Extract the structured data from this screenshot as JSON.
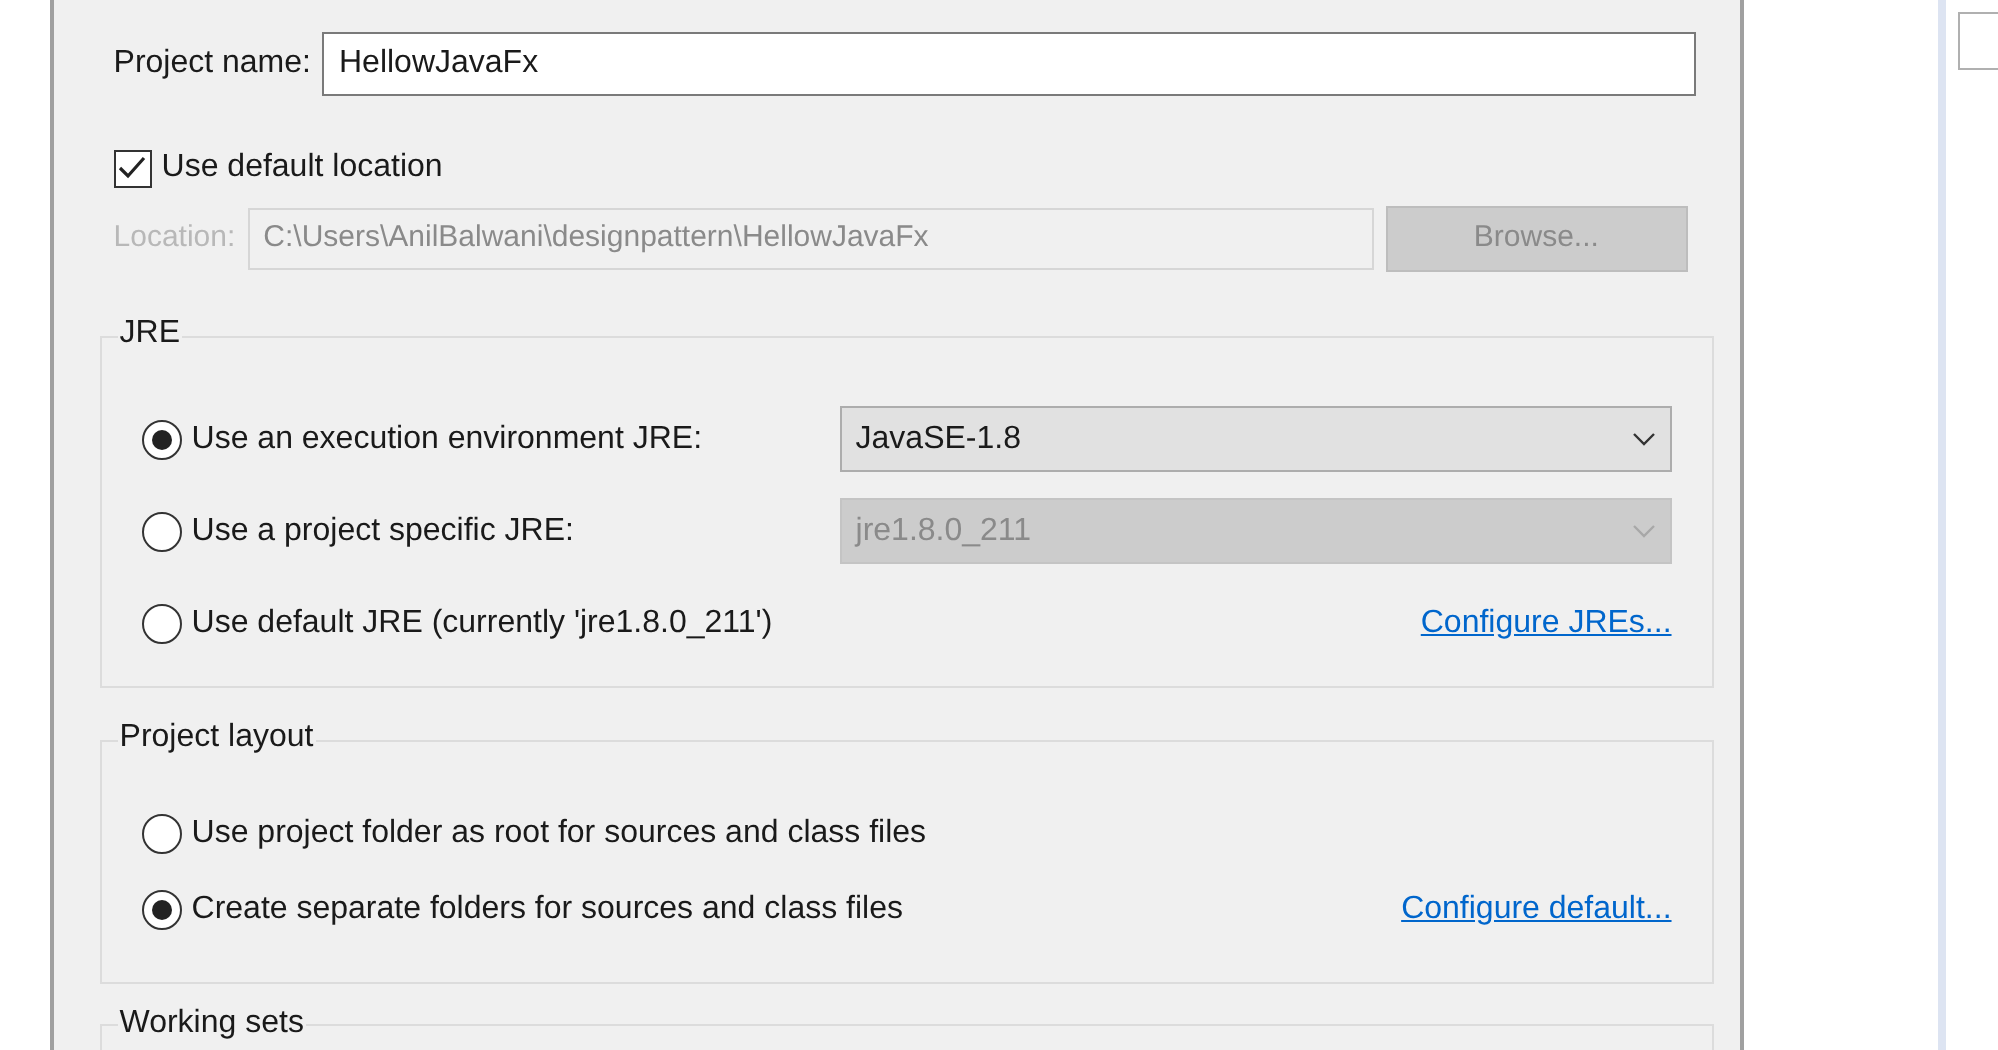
{
  "project_name": {
    "label": "Project name:",
    "value": "HellowJavaFx"
  },
  "use_default_location": {
    "label": "Use default location",
    "checked": true
  },
  "location": {
    "label": "Location:",
    "value": "C:\\Users\\AnilBalwani\\designpattern\\HellowJavaFx",
    "disabled": true
  },
  "browse_button": {
    "label": "Browse...",
    "disabled": true
  },
  "jre_group": {
    "title": "JRE",
    "options": [
      {
        "label": "Use an execution environment JRE:",
        "selected": true,
        "combo": {
          "value": "JavaSE-1.8",
          "disabled": false
        }
      },
      {
        "label": "Use a project specific JRE:",
        "selected": false,
        "combo": {
          "value": "jre1.8.0_211",
          "disabled": true
        }
      },
      {
        "label": "Use default JRE (currently 'jre1.8.0_211')",
        "selected": false,
        "link": "Configure JREs..."
      }
    ]
  },
  "layout_group": {
    "title": "Project layout",
    "options": [
      {
        "label": "Use project folder as root for sources and class files",
        "selected": false
      },
      {
        "label": "Create separate folders for sources and class files",
        "selected": true,
        "link": "Configure default..."
      }
    ]
  },
  "working_sets_group": {
    "title": "Working sets"
  }
}
